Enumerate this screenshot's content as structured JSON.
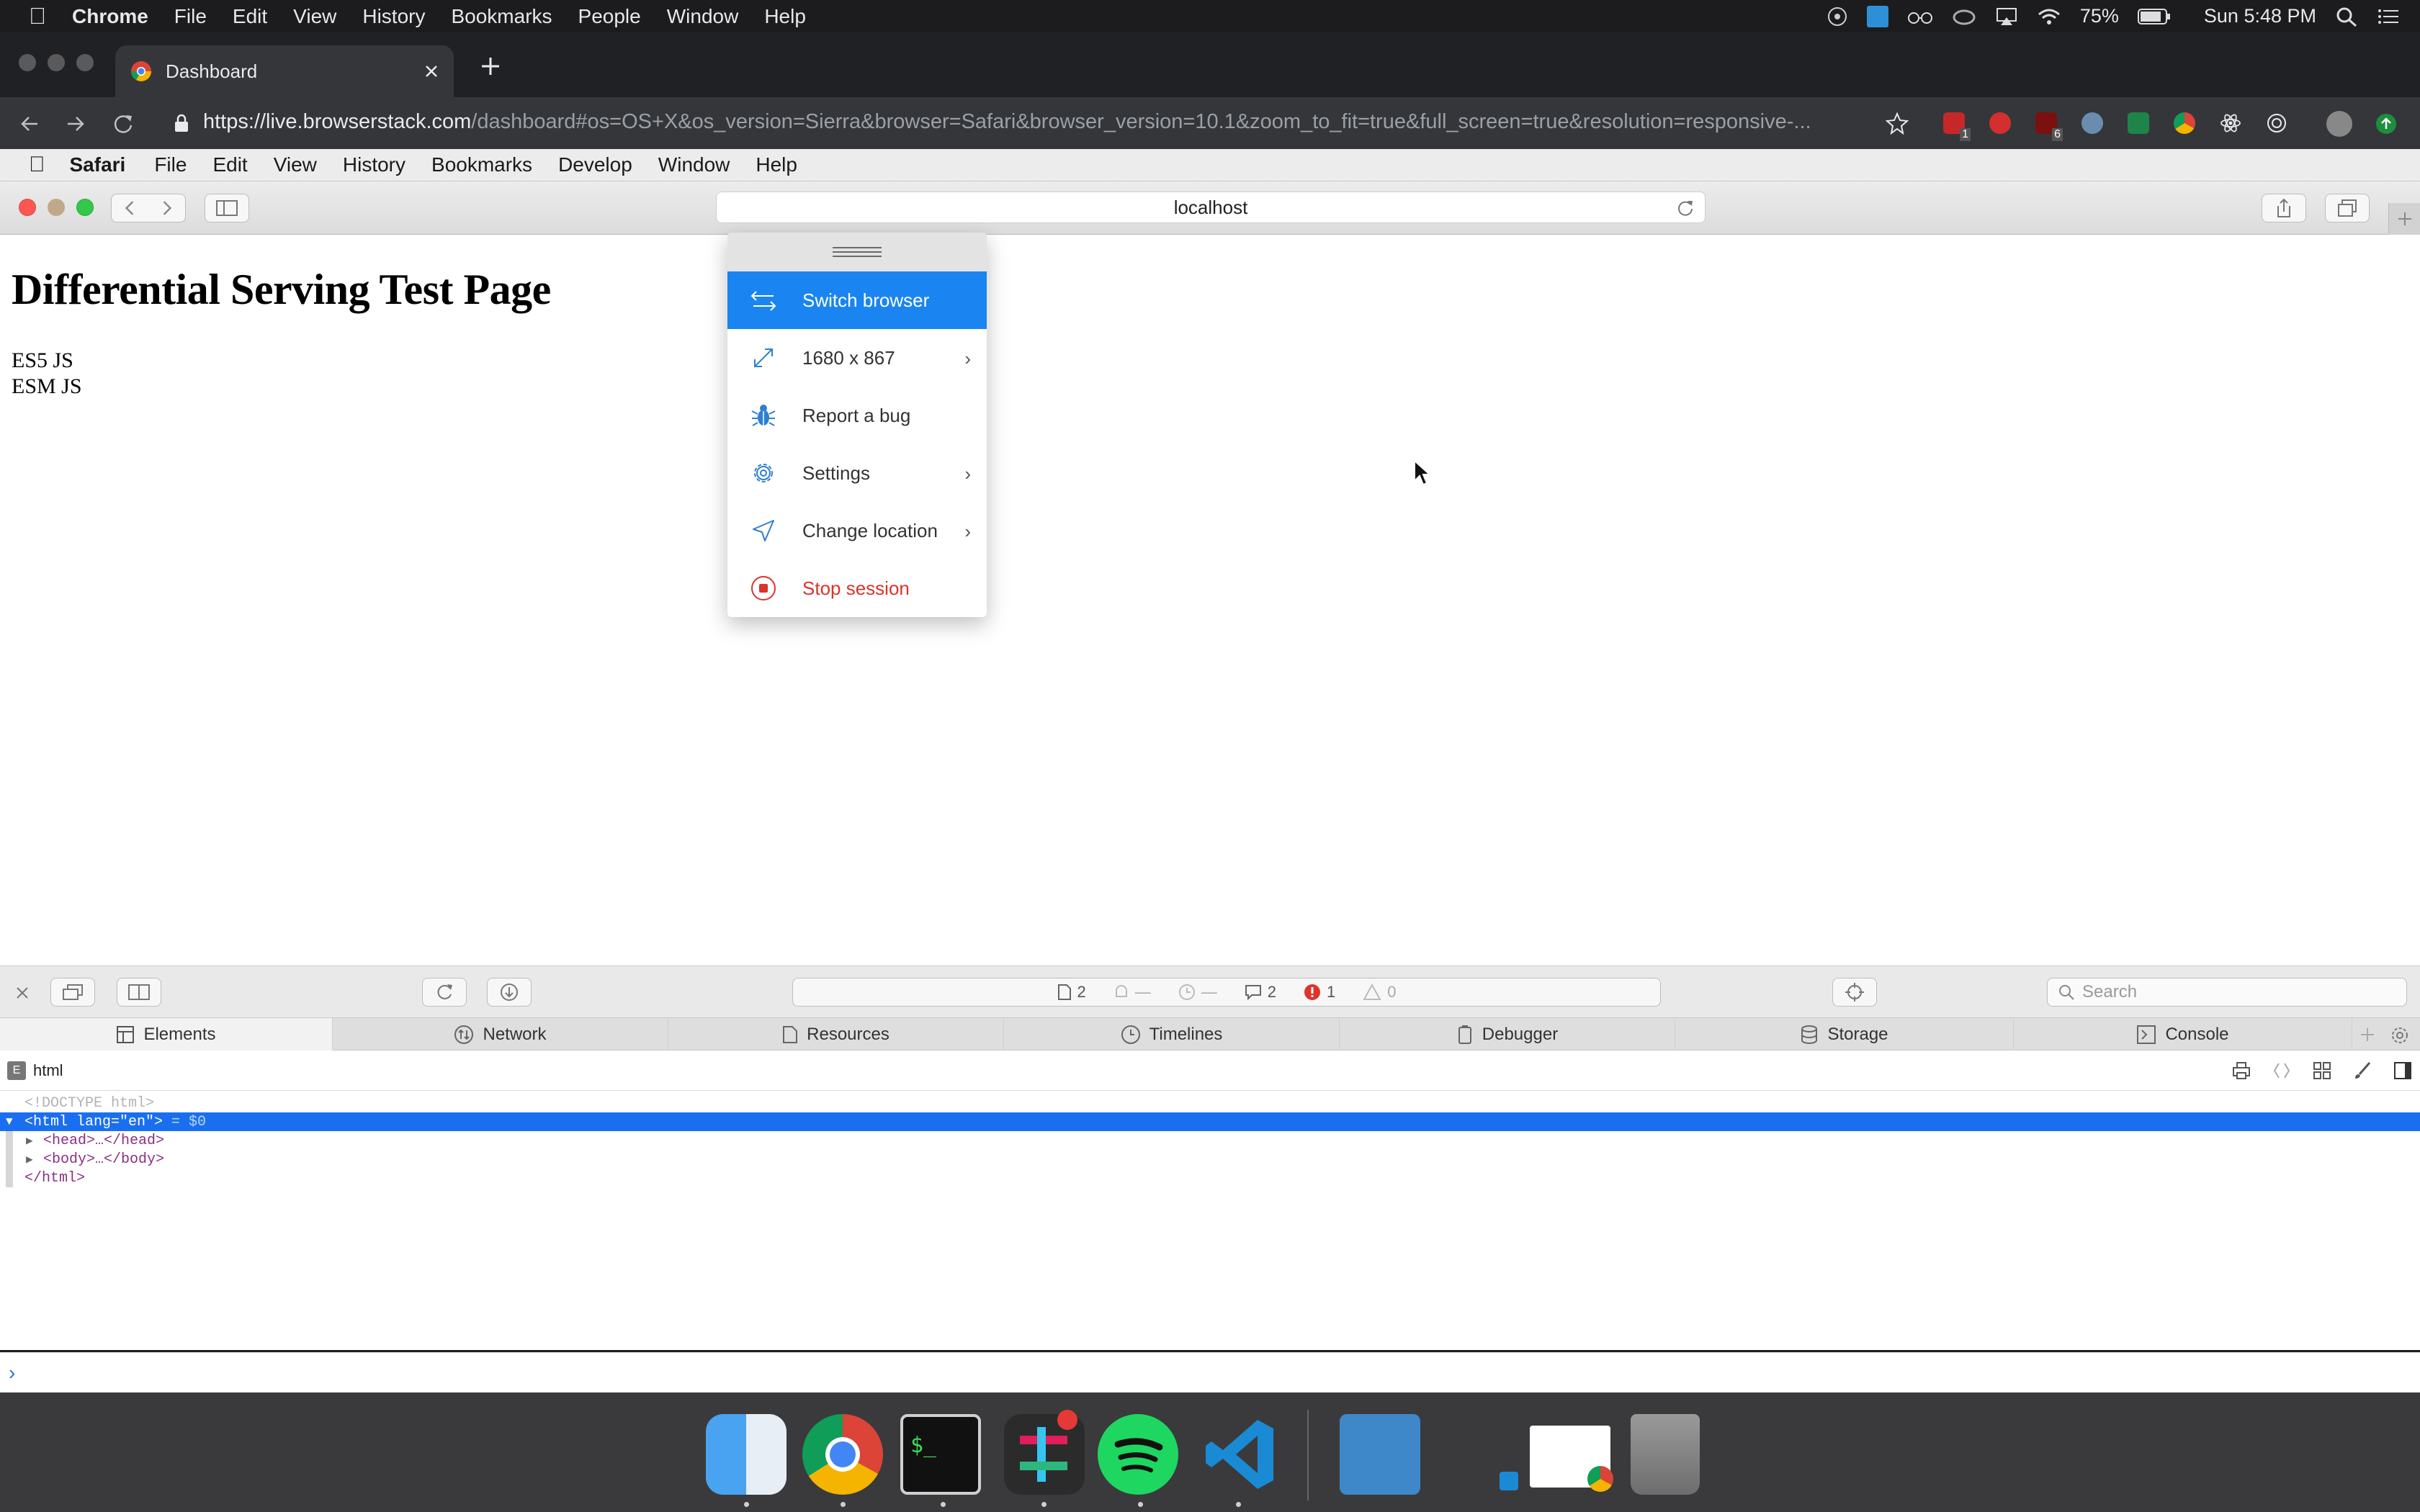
{
  "mac_menubar": {
    "app": "Chrome",
    "items": [
      "File",
      "Edit",
      "View",
      "History",
      "Bookmarks",
      "People",
      "Window",
      "Help"
    ],
    "battery": "75%",
    "clock": "Sun 5:48 PM"
  },
  "chrome": {
    "tab_title": "Dashboard",
    "url_host": "https://live.browserstack.com",
    "url_rest": "/dashboard#os=OS+X&os_version=Sierra&browser=Safari&browser_version=10.1&zoom_to_fit=true&full_screen=true&resolution=responsive-...",
    "ext_badges": {
      "first": "1",
      "ublock": "6"
    }
  },
  "safari": {
    "app": "Safari",
    "menu": [
      "File",
      "Edit",
      "View",
      "History",
      "Bookmarks",
      "Develop",
      "Window",
      "Help"
    ],
    "address": "localhost"
  },
  "page": {
    "heading": "Differential Serving Test Page",
    "lines": [
      "ES5 JS",
      "ESM JS"
    ]
  },
  "popup": {
    "items": [
      {
        "label": "Switch browser",
        "icon": "switch-arrows-icon",
        "selected": true
      },
      {
        "label": "1680 x 867",
        "icon": "resize-icon",
        "submenu": true
      },
      {
        "label": "Report a bug",
        "icon": "bug-icon"
      },
      {
        "label": "Settings",
        "icon": "gear-icon",
        "submenu": true
      },
      {
        "label": "Change location",
        "icon": "location-arrow-icon",
        "submenu": true
      },
      {
        "label": "Stop session",
        "icon": "stop-icon",
        "danger": true
      }
    ],
    "chevron": "›"
  },
  "devtools": {
    "counters": {
      "resources": "2",
      "issues": "—",
      "time": "—",
      "logs": "2",
      "errors": "1",
      "warnings": "0"
    },
    "search_placeholder": "Search",
    "tabs": [
      "Elements",
      "Network",
      "Resources",
      "Timelines",
      "Debugger",
      "Storage",
      "Console"
    ],
    "crumb_badge": "E",
    "crumb": "html",
    "dom": {
      "doctype": "<!DOCTYPE html>",
      "html_open": "<html lang=\"en\">",
      "selected_marker": " = $0",
      "head": "<head>…</head>",
      "body": "<body>…</body>",
      "html_close": "</html>"
    },
    "console_prompt": "›"
  },
  "colors": {
    "accent": "#1a85f0",
    "danger": "#d9342b",
    "selection": "#1a6ff0"
  }
}
